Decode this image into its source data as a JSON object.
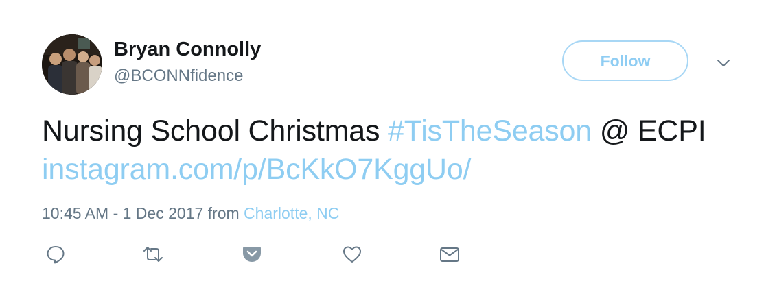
{
  "user": {
    "name": "Bryan Connolly",
    "handle": "@BCONNfidence"
  },
  "follow_button": {
    "label": "Follow"
  },
  "tweet": {
    "text_start": "Nursing School Christmas ",
    "hashtag": "#TisTheSeason",
    "text_mid": " @ ECPI ",
    "link": "instagram.com/p/BcKkO7KggUo/"
  },
  "meta": {
    "timestamp": "10:45 AM - 1 Dec 2017",
    "from_label": " from ",
    "location": "Charlotte, NC"
  },
  "icons": {
    "reply": "reply-icon",
    "retweet": "retweet-icon",
    "pocket": "pocket-icon",
    "like": "heart-icon",
    "message": "envelope-icon",
    "caret": "chevron-down-icon"
  },
  "colors": {
    "link": "#8ecdf2",
    "follow_border": "#a8d7f5",
    "secondary_text": "#657786",
    "icon": "#657786",
    "pocket": "#8899a6"
  }
}
